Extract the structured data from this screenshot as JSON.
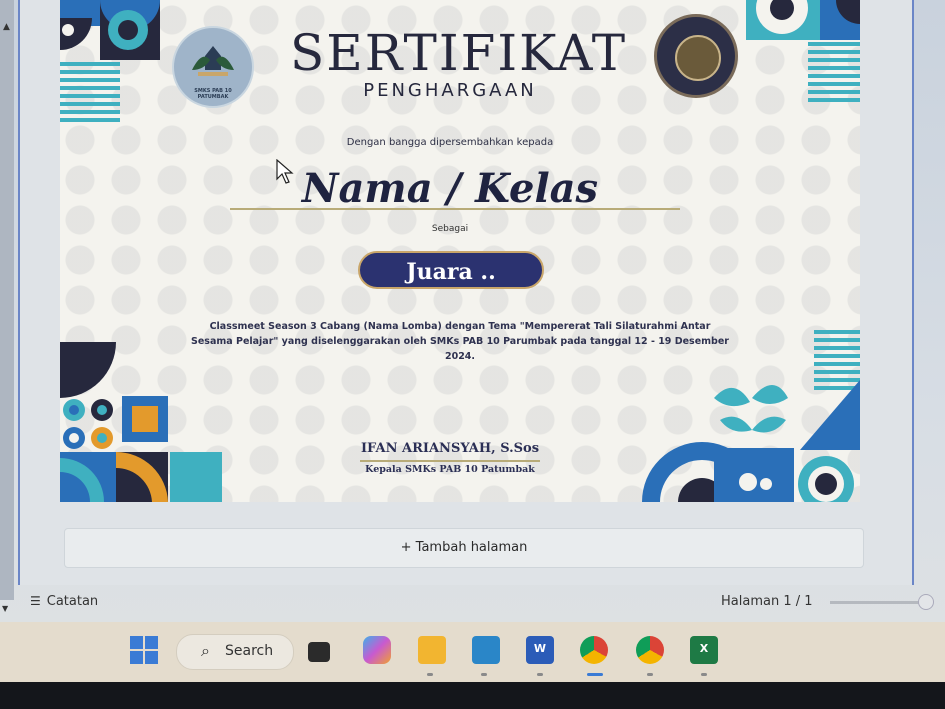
{
  "certificate": {
    "title": "SERTIFIKAT",
    "subtitle": "PENGHARGAAN",
    "presented_text": "Dengan bangga dipersembahkan kepada",
    "recipient": "Nama / Kelas",
    "as_text": "Sebagai",
    "award": "Juara ..",
    "description": "Classmeet Season 3 Cabang (Nama Lomba) dengan Tema \"Mempererat Tali Silaturahmi Antar Sesama Pelajar\" yang diselenggarakan oleh SMKs PAB 10 Parumbak pada tanggal 12 - 19 Desember 2024.",
    "signer_name": "IFAN ARIANSYAH, S.Sos",
    "signer_role": "Kepala SMKs PAB 10 Patumbak",
    "logo_left_text": "SMKS PAB 10 PATUMBAK"
  },
  "editor": {
    "add_page_label": "+ Tambah halaman",
    "notes_label": "Catatan",
    "page_indicator": "Halaman 1 / 1"
  },
  "taskbar": {
    "search_label": "Search",
    "apps": [
      "start-icon",
      "search-icon",
      "task-view-icon",
      "copilot-icon",
      "file-explorer-icon",
      "photos-icon",
      "word-icon",
      "chrome-profile-icon",
      "chrome-ad-icon",
      "excel-icon"
    ]
  },
  "colors": {
    "navy": "#26283d",
    "accent_blue": "#2a6fb8",
    "teal": "#3fb0c0",
    "gold": "#c9a66a",
    "orange": "#e39a2c"
  }
}
